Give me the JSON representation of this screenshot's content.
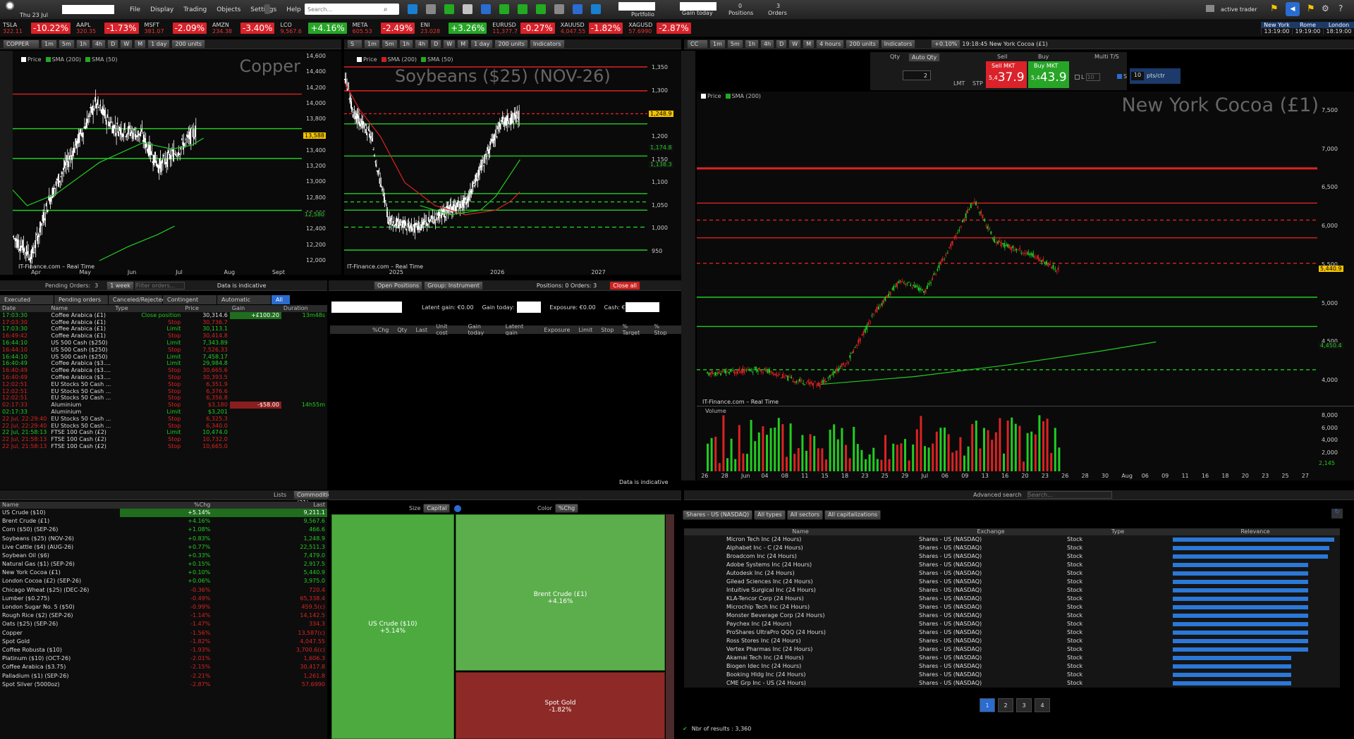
{
  "app": {
    "date": "Thu 23 Jul",
    "menu": [
      "File",
      "Display",
      "Trading",
      "Objects",
      "Settings",
      "Help"
    ],
    "search_placeholder": "Search...",
    "portfolio": "Portfolio",
    "gain_today": "Gain today",
    "positions_count": "0",
    "positions": "Positions",
    "orders_count": "3",
    "orders": "Orders",
    "active_trader": "active trader"
  },
  "clocks": [
    {
      "city": "New York",
      "time": "13:19:00"
    },
    {
      "city": "Rome",
      "time": "19:19:00"
    },
    {
      "city": "London",
      "time": "18:19:00"
    }
  ],
  "tickers": [
    {
      "sym": "TSLA",
      "price": "322.11",
      "chg": "-10.22%",
      "dir": "neg"
    },
    {
      "sym": "AAPL",
      "price": "320.35",
      "chg": "-1.73%",
      "dir": "neg"
    },
    {
      "sym": "MSFT",
      "price": "381.07",
      "chg": "-2.09%",
      "dir": "neg"
    },
    {
      "sym": "AMZN",
      "price": "234.38",
      "chg": "-3.40%",
      "dir": "neg"
    },
    {
      "sym": "LCO",
      "price": "9,567.6",
      "chg": "+4.16%",
      "dir": "pos"
    },
    {
      "sym": "META",
      "price": "605.53",
      "chg": "-2.49%",
      "dir": "neg"
    },
    {
      "sym": "ENI",
      "price": "23.028",
      "chg": "+3.26%",
      "dir": "pos"
    },
    {
      "sym": "EURUSD",
      "price": "11,377.7",
      "chg": "-0.27%",
      "dir": "neg"
    },
    {
      "sym": "XAUUSD",
      "price": "4,047.55",
      "chg": "-1.82%",
      "dir": "neg"
    },
    {
      "sym": "XAGUSD",
      "price": "57.6990",
      "chg": "-2.87%",
      "dir": "neg"
    }
  ],
  "chart1": {
    "symbol": "COPPER",
    "tf": "1 day",
    "units": "200 units",
    "title": "Copper",
    "legend": [
      "Price",
      "SMA (200)",
      "SMA (50)"
    ],
    "y": [
      "14,600",
      "14,400",
      "14,200",
      "14,000",
      "13,800",
      "13,600",
      "13,400",
      "13,200",
      "13,000",
      "12,800",
      "12,600",
      "12,400",
      "12,200",
      "12,000"
    ],
    "x": [
      "Apr",
      "May",
      "Jun",
      "Jul",
      "Aug",
      "Sept"
    ],
    "last": "13,588",
    "lvl": "12,580",
    "footer": "IT-Finance.com – Real Time"
  },
  "chart2": {
    "symbol": "S",
    "tf": "1 day",
    "units": "200 units",
    "title": "Soybeans ($25) (NOV-26)",
    "legend": [
      "Price",
      "SMA (200)",
      "SMA (50)"
    ],
    "y": [
      "1,350",
      "1,300",
      "1,250",
      "1,200",
      "1,150",
      "1,100",
      "1,050",
      "1,000",
      "950"
    ],
    "x": [
      "2025",
      "2026",
      "2027"
    ],
    "last": "1,248.9",
    "l2": "1,174.8",
    "l3": "1,138.3",
    "footer": "IT-Finance.com – Real Time",
    "indicators": "Indicators"
  },
  "chart3": {
    "symbol": "CC",
    "tf": "4 hours",
    "units": "200 units",
    "title": "New York Cocoa (£1)",
    "legend": [
      "Price",
      "SMA (200)"
    ],
    "y": [
      "7,500",
      "7,000",
      "6,500",
      "6,000",
      "5,500",
      "5,000",
      "4,500",
      "4,000"
    ],
    "last": "5,440.9",
    "lvl": "4,450.4",
    "vol_label": "Volume",
    "vy": [
      "8,000",
      "6,000",
      "4,000",
      "2,000"
    ],
    "vlast": "2,145",
    "x": [
      "26",
      "28",
      "Jun",
      "04",
      "08",
      "11",
      "15",
      "18",
      "23",
      "25",
      "29",
      "Jul",
      "06",
      "09",
      "13",
      "16",
      "20",
      "23",
      "26",
      "28",
      "30",
      "Aug",
      "06",
      "09",
      "11",
      "16",
      "18",
      "20",
      "23",
      "25",
      "27"
    ],
    "footer": "IT-Finance.com – Real Time",
    "header_time": "19:18:45 New York Cocoa (£1)",
    "header_pct": "+0.10%",
    "indicators": "Indicators"
  },
  "trade": {
    "qty": "Qty",
    "auto_qty": "Auto Qty",
    "qty_val": "2",
    "sell": "Sell",
    "buy": "Buy",
    "sell_mkt": "Sell MKT",
    "buy_mkt": "Buy MKT",
    "sell_price_small": "5,4",
    "sell_price": "37.9",
    "buy_price_small": "5,4",
    "buy_price": "43.9",
    "lmt": "LMT",
    "stp": "STP",
    "multi": "Multi T/S",
    "l_val": "10",
    "s_val": "10",
    "ptsctr": "pts/ctr",
    "L": "L",
    "S": "S"
  },
  "orders": {
    "pending_label": "Pending Orders:",
    "pending_count": "3",
    "period": "1 week",
    "filter_placeholder": "Filter orders...",
    "indicative": "Data is indicative",
    "tabs": [
      "Executed",
      "Pending orders",
      "Canceled/Rejected",
      "Contingent Orders",
      "Automatic trading",
      "All"
    ],
    "cols": [
      "Date",
      "Name",
      "Type",
      "Price",
      "Gain",
      "Duration"
    ],
    "rows": [
      [
        "17:03:30",
        "Coffee Arabica (£1)",
        "Close position",
        "30,314.6",
        "+£100.20",
        "13m48s"
      ],
      [
        "17:03:30",
        "Coffee Arabica (£1)",
        "Stop",
        "30,736.7",
        "",
        ""
      ],
      [
        "17:03:30",
        "Coffee Arabica (£1)",
        "Limit",
        "30,113.1",
        "",
        ""
      ],
      [
        "16:49:42",
        "Coffee Arabica (£1)",
        "Stop",
        "30,414.8",
        "",
        ""
      ],
      [
        "16:44:10",
        "US 500 Cash ($250)",
        "Limit",
        "7,343.89",
        "",
        ""
      ],
      [
        "16:44:10",
        "US 500 Cash ($250)",
        "Stop",
        "7,526.33",
        "",
        ""
      ],
      [
        "16:44:10",
        "US 500 Cash ($250)",
        "Limit",
        "7,458.17",
        "",
        ""
      ],
      [
        "16:40:49",
        "Coffee Arabica ($3....",
        "Limit",
        "29,984.8",
        "",
        ""
      ],
      [
        "16:40:49",
        "Coffee Arabica ($3....",
        "Stop",
        "30,665.6",
        "",
        ""
      ],
      [
        "16:40:49",
        "Coffee Arabica ($3....",
        "Stop",
        "30,393.5",
        "",
        ""
      ],
      [
        "12:02:51",
        "EU Stocks 50 Cash ...",
        "Stop",
        "6,351.9",
        "",
        ""
      ],
      [
        "12:02:51",
        "EU Stocks 50 Cash ...",
        "Stop",
        "6,376.6",
        "",
        ""
      ],
      [
        "12:02:51",
        "EU Stocks 50 Cash ...",
        "Stop",
        "6,356.8",
        "",
        ""
      ],
      [
        "02:17:33",
        "Aluminium",
        "Stop",
        "$3,180",
        "-$58.00",
        "14h55m"
      ],
      [
        "02:17:33",
        "Aluminium",
        "Limit",
        "$3,201",
        "",
        ""
      ],
      [
        "22 Jul, 22:29:40",
        "EU Stocks 50 Cash ...",
        "Stop",
        "6,325.3",
        "",
        ""
      ],
      [
        "22 Jul, 22:29:40",
        "EU Stocks 50 Cash ...",
        "Stop",
        "6,340.0",
        "",
        ""
      ],
      [
        "22 Jul, 21:58:13",
        "FTSE 100 Cash (£2)",
        "Limit",
        "10,474.0",
        "",
        ""
      ],
      [
        "22 Jul, 21:58:13",
        "FTSE 100 Cash (£2)",
        "Stop",
        "10,732.0",
        "",
        ""
      ],
      [
        "22 Jul, 21:58:13",
        "FTSE 100 Cash (£2)",
        "Stop",
        "10,665.0",
        "",
        ""
      ]
    ]
  },
  "positions": {
    "tab": "Open Positions",
    "group": "Group: Instrument",
    "summary": "Positions: 0  Orders: 3",
    "close_all": "Close all",
    "latent_gain": "Latent gain: €0.00",
    "gain_today": "Gain today:",
    "exposure": "Exposure: €0.00",
    "cash": "Cash: €",
    "cols": [
      "%Chg",
      "Qty",
      "Last",
      "Unit cost",
      "Gain today",
      "Latent gain",
      "Exposure",
      "Limit",
      "Stop",
      "% Target",
      "% Stop"
    ],
    "indicative": "Data is indicative"
  },
  "lists": {
    "tab": "Lists",
    "list": "Commodities (21)",
    "cols": [
      "Name",
      "%Chg",
      "Last"
    ],
    "rows": [
      [
        "US Crude ($10)",
        "+5.14%",
        "9,211.1",
        "pos"
      ],
      [
        "Brent Crude (£1)",
        "+4.16%",
        "9,567.6",
        "pos"
      ],
      [
        "Corn ($50) (SEP-26)",
        "+1.08%",
        "466.6",
        "pos"
      ],
      [
        "Soybeans ($25) (NOV-26)",
        "+0.83%",
        "1,248.9",
        "pos"
      ],
      [
        "Live Cattle ($4) (AUG-26)",
        "+0.77%",
        "22,511.3",
        "pos"
      ],
      [
        "Soybean Oil ($6)",
        "+0.33%",
        "7,479.0",
        "pos"
      ],
      [
        "Natural Gas ($1) (SEP-26)",
        "+0.15%",
        "2,917.5",
        "pos"
      ],
      [
        "New York Cocoa (£1)",
        "+0.10%",
        "5,440.9",
        "pos"
      ],
      [
        "London Cocoa (£2) (SEP-26)",
        "+0.06%",
        "3,975.0",
        "pos"
      ],
      [
        "Chicago Wheat ($25) (DEC-26)",
        "-0.36%",
        "720.4",
        "neg"
      ],
      [
        "Lumber ($0.275)",
        "-0.49%",
        "65,338.4",
        "neg"
      ],
      [
        "London Sugar No. 5 ($50)",
        "-0.99%",
        "459.5(c)",
        "neg"
      ],
      [
        "Rough Rice ($2) (SEP-26)",
        "-1.14%",
        "14,142.5",
        "neg"
      ],
      [
        "Oats ($25) (SEP-26)",
        "-1.47%",
        "334.3",
        "neg"
      ],
      [
        "Copper",
        "-1.56%",
        "13,587(c)",
        "neg"
      ],
      [
        "Spot Gold",
        "-1.82%",
        "4,047.55",
        "neg"
      ],
      [
        "Coffee Robusta ($10)",
        "-1.93%",
        "3,700.6(c)",
        "neg"
      ],
      [
        "Platinum ($10) (OCT-26)",
        "-2.01%",
        "1,606.3",
        "neg"
      ],
      [
        "Coffee Arabica ($3.75)",
        "-2.15%",
        "30,417.8",
        "neg"
      ],
      [
        "Palladium ($1) (SEP-26)",
        "-2.21%",
        "1,261.8",
        "neg"
      ],
      [
        "Spot Silver (5000oz)",
        "-2.87%",
        "57.6990",
        "neg"
      ]
    ]
  },
  "heatmap": {
    "size_label": "Size",
    "size_val": "Capital",
    "color_label": "Color",
    "color_val": "%Chg",
    "cells": [
      {
        "name": "US Crude ($10)",
        "pct": "+5.14%"
      },
      {
        "name": "Brent Crude (£1)",
        "pct": "+4.16%"
      },
      {
        "name": "Spot Gold",
        "pct": "-1.82%"
      }
    ]
  },
  "search": {
    "title": "Advanced search",
    "placeholder": "Search...",
    "filters": [
      "Shares - US (NASDAQ)",
      "All types",
      "All sectors",
      "All capitalizations"
    ],
    "cols": [
      "Name",
      "Exchange",
      "Type",
      "Relevance"
    ],
    "rows": [
      [
        "Micron Tech Inc (24 Hours)",
        "Shares - US (NASDAQ)",
        "Stock",
        98
      ],
      [
        "Alphabet Inc - C (24 Hours)",
        "Shares - US (NASDAQ)",
        "Stock",
        95
      ],
      [
        "Broadcom Inc (24 Hours)",
        "Shares - US (NASDAQ)",
        "Stock",
        94
      ],
      [
        "Adobe Systems Inc (24 Hours)",
        "Shares - US (NASDAQ)",
        "Stock",
        82
      ],
      [
        "Autodesk Inc (24 Hours)",
        "Shares - US (NASDAQ)",
        "Stock",
        82
      ],
      [
        "Gilead Sciences Inc (24 Hours)",
        "Shares - US (NASDAQ)",
        "Stock",
        82
      ],
      [
        "Intuitive Surgical Inc (24 Hours)",
        "Shares - US (NASDAQ)",
        "Stock",
        82
      ],
      [
        "KLA-Tencor Corp (24 Hours)",
        "Shares - US (NASDAQ)",
        "Stock",
        82
      ],
      [
        "Microchip Tech Inc (24 Hours)",
        "Shares - US (NASDAQ)",
        "Stock",
        82
      ],
      [
        "Monster Beverage Corp (24 Hours)",
        "Shares - US (NASDAQ)",
        "Stock",
        82
      ],
      [
        "Paychex Inc (24 Hours)",
        "Shares - US (NASDAQ)",
        "Stock",
        82
      ],
      [
        "ProShares UltraPro QQQ (24 Hours)",
        "Shares - US (NASDAQ)",
        "Stock",
        82
      ],
      [
        "Ross Stores Inc (24 Hours)",
        "Shares - US (NASDAQ)",
        "Stock",
        82
      ],
      [
        "Vertex Pharmas Inc (24 Hours)",
        "Shares - US (NASDAQ)",
        "Stock",
        82
      ],
      [
        "Akamai Tech Inc (24 Hours)",
        "Shares - US (NASDAQ)",
        "Stock",
        72
      ],
      [
        "Biogen Idec Inc (24 Hours)",
        "Shares - US (NASDAQ)",
        "Stock",
        72
      ],
      [
        "Booking Hldg Inc (24 Hours)",
        "Shares - US (NASDAQ)",
        "Stock",
        72
      ],
      [
        "CME Grp Inc - US (24 Hours)",
        "Shares - US (NASDAQ)",
        "Stock",
        72
      ]
    ],
    "pages": [
      "1",
      "2",
      "3",
      "4"
    ],
    "results": "Nbr of results : 3,360"
  },
  "colors": {
    "pos": "#27a527",
    "neg": "#d9222a",
    "accent": "#2a6cd0"
  }
}
